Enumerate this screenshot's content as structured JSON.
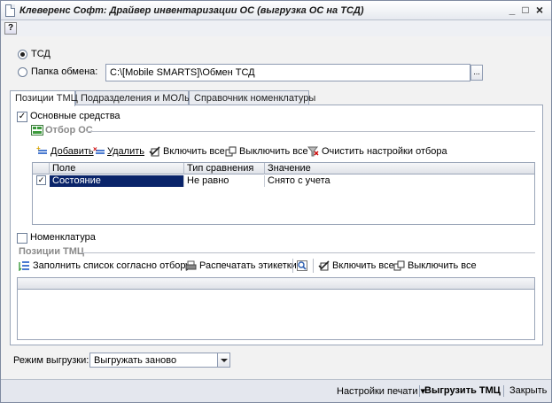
{
  "window": {
    "title": "Клеверенс Софт: Драйвер инвентаризации ОС (выгрузка ОС на ТСД)",
    "minimize": "_",
    "maximize": "□",
    "close": "×"
  },
  "help": "?",
  "target": {
    "tsd_label": "ТСД",
    "folder_label": "Папка обмена:",
    "folder_value": "C:\\[Mobile SMARTS]\\Обмен ТСД",
    "folder_button": "...",
    "selected": "ТСД"
  },
  "tabs": [
    {
      "label": "Позиции ТМЦ",
      "active": true
    },
    {
      "label": "Подразделения и МОЛы",
      "active": false
    },
    {
      "label": "Справочник номенклатуры",
      "active": false
    }
  ],
  "fixed_assets": {
    "checkbox_label": "Основные средства",
    "checked": true,
    "filter_title": "Отбор ОС",
    "toolbar": {
      "add": "Добавить",
      "delete": "Удалить",
      "enable_all": "Включить все",
      "disable_all": "Выключить все",
      "clear": "Очистить настройки отбора"
    },
    "table": {
      "columns": [
        "Поле",
        "Тип сравнения",
        "Значение"
      ],
      "rows": [
        {
          "checked": true,
          "field": "Состояние",
          "comparison": "Не равно",
          "value": "Снято с учета"
        }
      ]
    }
  },
  "nomenclature": {
    "checkbox_label": "Номенклатура",
    "checked": false,
    "positions_title": "Позиции ТМЦ",
    "toolbar": {
      "fill": "Заполнить список согласно отбору",
      "print_labels": "Распечатать этикетки",
      "enable_all": "Включить все",
      "disable_all": "Выключить все"
    }
  },
  "mode": {
    "label": "Режим выгрузки:",
    "value": "Выгружать заново"
  },
  "footer": {
    "print_settings": "Настройки печати ▾",
    "upload": "Выгрузить ТМЦ",
    "close": "Закрыть"
  },
  "colors": {
    "selection": "#0a246a",
    "accent_green": "#3a9a3a",
    "accent_blue": "#2d5fb0"
  }
}
